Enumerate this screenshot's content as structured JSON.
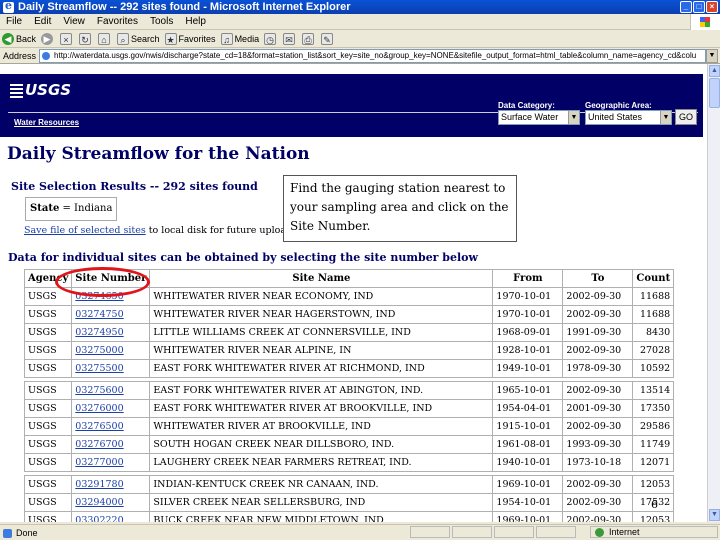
{
  "window": {
    "title": "Daily Streamflow -- 292 sites found - Microsoft Internet Explorer"
  },
  "menu": [
    "File",
    "Edit",
    "View",
    "Favorites",
    "Tools",
    "Help"
  ],
  "toolbar": {
    "back": "Back",
    "search": "Search",
    "favorites": "Favorites",
    "media": "Media"
  },
  "address": {
    "label": "Address",
    "url": "http://waterdata.usgs.gov/nwis/discharge?state_cd=18&format=station_list&sort_key=site_no&group_key=NONE&sitefile_output_format=html_table&column_name=agency_cd&colu"
  },
  "banner": {
    "logo": "USGS",
    "section": "Water Resources",
    "data_category_label": "Data Category:",
    "data_category_value": "Surface Water",
    "geo_area_label": "Geographic Area:",
    "geo_area_value": "United States",
    "go": "GO"
  },
  "page": {
    "title": "Daily Streamflow for the Nation",
    "results_heading": "Site Selection Results -- 292 sites found",
    "state_label": "State",
    "state_value": "= Indiana",
    "save_link": "Save file of selected sites",
    "save_suffix": " to local disk for future upload",
    "data_heading": "Data for individual sites can be obtained by selecting the site number below"
  },
  "callout": "Find the gauging station nearest to your sampling area and click on the Site Number.",
  "table": {
    "headers": [
      "Agency",
      "Site Number",
      "Site Name",
      "From",
      "To",
      "Count"
    ],
    "rows": [
      [
        "USGS",
        "03274650",
        "WHITEWATER RIVER NEAR ECONOMY, IND",
        "1970-10-01",
        "2002-09-30",
        "11688"
      ],
      [
        "USGS",
        "03274750",
        "WHITEWATER RIVER NEAR HAGERSTOWN, IND",
        "1970-10-01",
        "2002-09-30",
        "11688"
      ],
      [
        "USGS",
        "03274950",
        "LITTLE WILLIAMS CREEK AT CONNERSVILLE, IND",
        "1968-09-01",
        "1991-09-30",
        "8430"
      ],
      [
        "USGS",
        "03275000",
        "WHITEWATER RIVER NEAR ALPINE, IN",
        "1928-10-01",
        "2002-09-30",
        "27028"
      ],
      [
        "USGS",
        "03275500",
        "EAST FORK WHITEWATER RIVER AT RICHMOND, IND",
        "1949-10-01",
        "1978-09-30",
        "10592"
      ],
      [
        "USGS",
        "03275600",
        "EAST FORK WHITEWATER RIVER AT ABINGTON, IND.",
        "1965-10-01",
        "2002-09-30",
        "13514"
      ],
      [
        "USGS",
        "03276000",
        "EAST FORK WHITEWATER RIVER AT BROOKVILLE, IND",
        "1954-04-01",
        "2001-09-30",
        "17350"
      ],
      [
        "USGS",
        "03276500",
        "WHITEWATER RIVER AT BROOKVILLE, IND",
        "1915-10-01",
        "2002-09-30",
        "29586"
      ],
      [
        "USGS",
        "03276700",
        "SOUTH HOGAN CREEK NEAR DILLSBORO, IND.",
        "1961-08-01",
        "1993-09-30",
        "11749"
      ],
      [
        "USGS",
        "03277000",
        "LAUGHERY CREEK NEAR FARMERS RETREAT, IND.",
        "1940-10-01",
        "1973-10-18",
        "12071"
      ],
      [
        "USGS",
        "03291780",
        "INDIAN-KENTUCK CREEK NR CANAAN, IND.",
        "1969-10-01",
        "2002-09-30",
        "12053"
      ],
      [
        "USGS",
        "03294000",
        "SILVER CREEK NEAR SELLERSBURG, IND",
        "1954-10-01",
        "2002-09-30",
        "17532"
      ],
      [
        "USGS",
        "03302220",
        "BUCK CREEK NEAR NEW MIDDLETOWN, IND",
        "1969-10-01",
        "2002-09-30",
        "12053"
      ]
    ]
  },
  "slide_number": "6",
  "status": {
    "text": "Done",
    "zone": "Internet"
  }
}
